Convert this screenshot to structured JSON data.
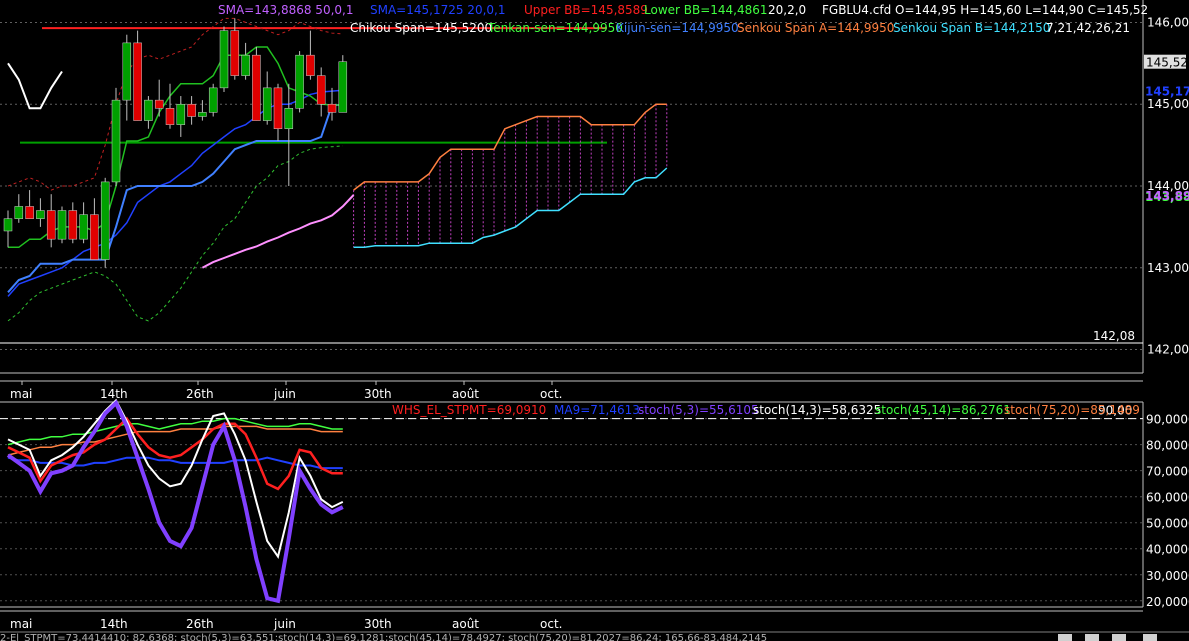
{
  "top_indicators": {
    "sma1": "SMA=143,8868  50,0,1",
    "sma2": "SMA=145,1725  20,0,1",
    "upper_bb": "Upper BB=145,8589",
    "lower_bb": "Lower BB=144,4861",
    "bb_params": "20,2,0",
    "ohlc": "FGBLU4.cfd O=144,95 H=145,60 L=144,90 C=145,52",
    "chikou": "Chikou Span=145,5200",
    "tenkan": "Tenkan-sen=144,9950",
    "kijun": "Kijun-sen=144,9950",
    "senkou_a": "Senkou Span A=144,9950",
    "senkou_b": "Senkou Span B=144,2150",
    "ichimoku_params": "7,21,42,26,21"
  },
  "bottom_indicators": {
    "whs": "WHS_EL_STPMT=69,0910",
    "ma9": "MA9=71,4613",
    "stoch1": "stoch(5,3)=55,6105",
    "stoch2": "stoch(14,3)=58,6325",
    "stoch3": "stoch(45,14)=86,2761",
    "stoch4": "stoch(75,20)=85,1489"
  },
  "colors": {
    "sma1": "#c060ff",
    "sma2": "#2040ff",
    "upper_bb": "#ff2020",
    "lower_bb": "#40ff40",
    "chikou": "#ffffff",
    "tenkan": "#40ff40",
    "kijun": "#4080ff",
    "senkou_a": "#ff8040",
    "senkou_b": "#40e0ff",
    "whs": "#ff2020",
    "ma9": "#2040ff",
    "stoch1": "#8040ff",
    "stoch2": "#ffffff",
    "stoch3": "#40ff40",
    "stoch4": "#ff8040",
    "bull": "#00a000",
    "bear": "#e00000"
  },
  "chart_data": [
    {
      "type": "candlestick",
      "ylim": [
        141.75,
        146.25
      ],
      "y_ticks": [
        "146,00",
        "145,00",
        "144,00",
        "143,00",
        "142,00"
      ],
      "price_labels": {
        "last": "145,52",
        "sma2": "145,17",
        "sma1": "143,89",
        "lower": "143,88",
        "level": "142,08"
      },
      "hlines": [
        {
          "name": "resistance",
          "value": 145.93,
          "color": "#ff2020"
        },
        {
          "name": "support",
          "value": 144.53,
          "color": "#00a000"
        },
        {
          "name": "low-level",
          "value": 142.08,
          "color": "#ffffff"
        }
      ],
      "candles": [
        [
          143.45,
          143.7,
          143.25,
          143.6
        ],
        [
          143.6,
          143.9,
          143.55,
          143.75
        ],
        [
          143.75,
          143.95,
          143.6,
          143.6
        ],
        [
          143.6,
          143.85,
          143.5,
          143.7
        ],
        [
          143.7,
          143.9,
          143.25,
          143.35
        ],
        [
          143.35,
          143.75,
          143.3,
          143.7
        ],
        [
          143.7,
          143.8,
          143.3,
          143.35
        ],
        [
          143.35,
          143.8,
          143.3,
          143.65
        ],
        [
          143.65,
          143.85,
          143.1,
          143.1
        ],
        [
          143.1,
          144.1,
          143.0,
          144.05
        ],
        [
          144.05,
          145.2,
          144.0,
          145.05
        ],
        [
          145.05,
          145.85,
          144.8,
          145.75
        ],
        [
          145.75,
          145.9,
          144.8,
          144.8
        ],
        [
          144.8,
          145.1,
          144.7,
          145.05
        ],
        [
          145.05,
          145.3,
          144.85,
          144.95
        ],
        [
          144.95,
          145.25,
          144.7,
          144.75
        ],
        [
          144.75,
          145.1,
          144.6,
          145.0
        ],
        [
          145.0,
          145.1,
          144.75,
          144.85
        ],
        [
          144.85,
          145.05,
          144.8,
          144.9
        ],
        [
          144.9,
          145.25,
          144.85,
          145.2
        ],
        [
          145.2,
          145.95,
          145.15,
          145.9
        ],
        [
          145.9,
          146.05,
          145.3,
          145.35
        ],
        [
          145.35,
          145.75,
          145.3,
          145.6
        ],
        [
          145.6,
          145.7,
          144.8,
          144.8
        ],
        [
          144.8,
          145.4,
          144.75,
          145.2
        ],
        [
          145.2,
          145.25,
          144.55,
          144.7
        ],
        [
          144.7,
          145.25,
          144.0,
          144.95
        ],
        [
          144.95,
          145.65,
          144.9,
          145.6
        ],
        [
          145.6,
          145.9,
          145.3,
          145.35
        ],
        [
          145.35,
          145.45,
          144.85,
          145.0
        ],
        [
          145.0,
          145.2,
          144.8,
          144.9
        ],
        [
          144.9,
          145.6,
          144.9,
          145.52
        ]
      ],
      "upper_bb": [
        144.0,
        144.05,
        144.1,
        144.05,
        143.95,
        144.0,
        144.0,
        144.05,
        144.1,
        144.5,
        145.0,
        145.4,
        145.55,
        145.6,
        145.55,
        145.6,
        145.65,
        145.7,
        145.85,
        145.95,
        146.05,
        146.05,
        146.0,
        145.95,
        145.9,
        145.85,
        145.9,
        146.0,
        145.95,
        145.9,
        145.87,
        145.86
      ],
      "lower_bb": [
        142.35,
        142.45,
        142.6,
        142.7,
        142.75,
        142.8,
        142.85,
        142.9,
        142.95,
        142.9,
        142.8,
        142.6,
        142.4,
        142.35,
        142.45,
        142.6,
        142.75,
        142.95,
        143.15,
        143.3,
        143.5,
        143.6,
        143.8,
        144.0,
        144.1,
        144.25,
        144.3,
        144.4,
        144.45,
        144.47,
        144.48,
        144.49
      ],
      "tenkan": [
        143.25,
        143.25,
        143.35,
        143.35,
        143.45,
        143.5,
        143.5,
        143.5,
        143.45,
        143.55,
        144.0,
        144.55,
        144.55,
        144.6,
        144.9,
        145.1,
        145.25,
        145.25,
        145.25,
        145.35,
        145.6,
        145.6,
        145.6,
        145.7,
        145.7,
        145.5,
        145.2,
        145.15,
        145.1,
        145.0,
        144.99,
        144.99
      ],
      "kijun": [
        142.7,
        142.85,
        142.9,
        143.05,
        143.05,
        143.05,
        143.1,
        143.1,
        143.1,
        143.1,
        143.5,
        143.95,
        144.0,
        144.0,
        144.0,
        144.0,
        144.0,
        144.0,
        144.05,
        144.15,
        144.3,
        144.45,
        144.5,
        144.55,
        144.55,
        144.55,
        144.55,
        144.55,
        144.55,
        144.6,
        144.99,
        144.99
      ],
      "sma20": [
        142.65,
        142.8,
        142.85,
        142.9,
        142.95,
        143.0,
        143.1,
        143.2,
        143.25,
        143.3,
        143.4,
        143.55,
        143.8,
        143.9,
        144.0,
        144.05,
        144.15,
        144.25,
        144.4,
        144.5,
        144.6,
        144.7,
        144.75,
        144.85,
        144.95,
        145.0,
        145.0,
        145.05,
        145.12,
        145.15,
        145.16,
        145.17
      ],
      "sma50_start_index": 18,
      "sma50": [
        143.0,
        143.07,
        143.12,
        143.17,
        143.22,
        143.26,
        143.32,
        143.37,
        143.43,
        143.48,
        143.54,
        143.58,
        143.64,
        143.75,
        143.89
      ],
      "chikou": [
        145.5,
        145.3,
        144.95,
        144.95,
        145.2,
        145.4
      ],
      "cloud_start_index": 32,
      "senkou_a": [
        143.95,
        144.05,
        144.05,
        144.05,
        144.05,
        144.05,
        144.05,
        144.15,
        144.35,
        144.45,
        144.45,
        144.45,
        144.45,
        144.45,
        144.7,
        144.75,
        144.8,
        144.85,
        144.85,
        144.85,
        144.85,
        144.85,
        144.75,
        144.75,
        144.75,
        144.75,
        144.75,
        144.9,
        145.0,
        145.0
      ],
      "senkou_b": [
        143.25,
        143.25,
        143.27,
        143.27,
        143.27,
        143.27,
        143.27,
        143.3,
        143.3,
        143.3,
        143.3,
        143.3,
        143.37,
        143.4,
        143.45,
        143.5,
        143.6,
        143.7,
        143.7,
        143.7,
        143.8,
        143.9,
        143.9,
        143.9,
        143.9,
        143.9,
        144.05,
        144.1,
        144.1,
        144.22
      ]
    },
    {
      "type": "line",
      "ylim": [
        18,
        96
      ],
      "y_ticks": [
        "90,0000",
        "80,0000",
        "70,0000",
        "60,0000",
        "50,0000",
        "40,0000",
        "30,0000",
        "20,0000"
      ],
      "threshold_label": "90,00",
      "threshold": 90,
      "series": [
        {
          "key": "stoch4",
          "values": [
            76,
            77,
            78,
            79,
            79,
            80,
            80,
            81,
            81,
            82,
            83,
            84,
            85,
            85,
            85,
            85,
            86,
            86,
            86,
            86,
            87,
            87,
            87,
            87,
            86,
            86,
            86,
            86,
            86,
            85,
            85,
            85
          ]
        },
        {
          "key": "stoch3",
          "values": [
            80,
            81,
            82,
            82,
            83,
            83,
            84,
            84,
            85,
            86,
            87,
            88,
            88,
            87,
            86,
            87,
            88,
            88,
            89,
            89,
            90,
            90,
            89,
            88,
            87,
            87,
            87,
            88,
            88,
            87,
            86,
            86
          ]
        },
        {
          "key": "ma9",
          "values": [
            75,
            74,
            74,
            73,
            73,
            73,
            72,
            72,
            73,
            73,
            74,
            75,
            75,
            75,
            74,
            74,
            73,
            73,
            73,
            73,
            73,
            74,
            74,
            74,
            75,
            74,
            73,
            72,
            72,
            71,
            71,
            71
          ]
        },
        {
          "key": "whs",
          "values": [
            79,
            77,
            75,
            66,
            72,
            74,
            76,
            77,
            80,
            82,
            86,
            90,
            84,
            79,
            76,
            75,
            76,
            79,
            82,
            86,
            88,
            88,
            84,
            75,
            65,
            63,
            68,
            78,
            77,
            71,
            69,
            69
          ]
        },
        {
          "key": "stoch2",
          "values": [
            82,
            80,
            78,
            68,
            74,
            76,
            79,
            83,
            88,
            93,
            97,
            89,
            80,
            72,
            67,
            64,
            65,
            72,
            82,
            91,
            92,
            84,
            74,
            58,
            43,
            37,
            54,
            75,
            68,
            59,
            56,
            58
          ]
        },
        {
          "key": "stoch1",
          "values": [
            76,
            73,
            70,
            62,
            69,
            70,
            72,
            79,
            85,
            92,
            96,
            87,
            75,
            63,
            50,
            43,
            41,
            48,
            64,
            80,
            87,
            74,
            56,
            36,
            21,
            20,
            44,
            70,
            63,
            57,
            54,
            56
          ]
        }
      ]
    }
  ],
  "x_labels": [
    "mai",
    "14th",
    "26th",
    "juin",
    "30th",
    "août",
    "oct."
  ],
  "bottom_text": "2-El_STPMT=73,4414410; 82,6368; stoch(5,3)=63,551;stoch(14,3)=69,1281;stoch(45,14)=78,4927; stoch(75,20)=81,2027=86,24; 165,66-83,484,2145"
}
